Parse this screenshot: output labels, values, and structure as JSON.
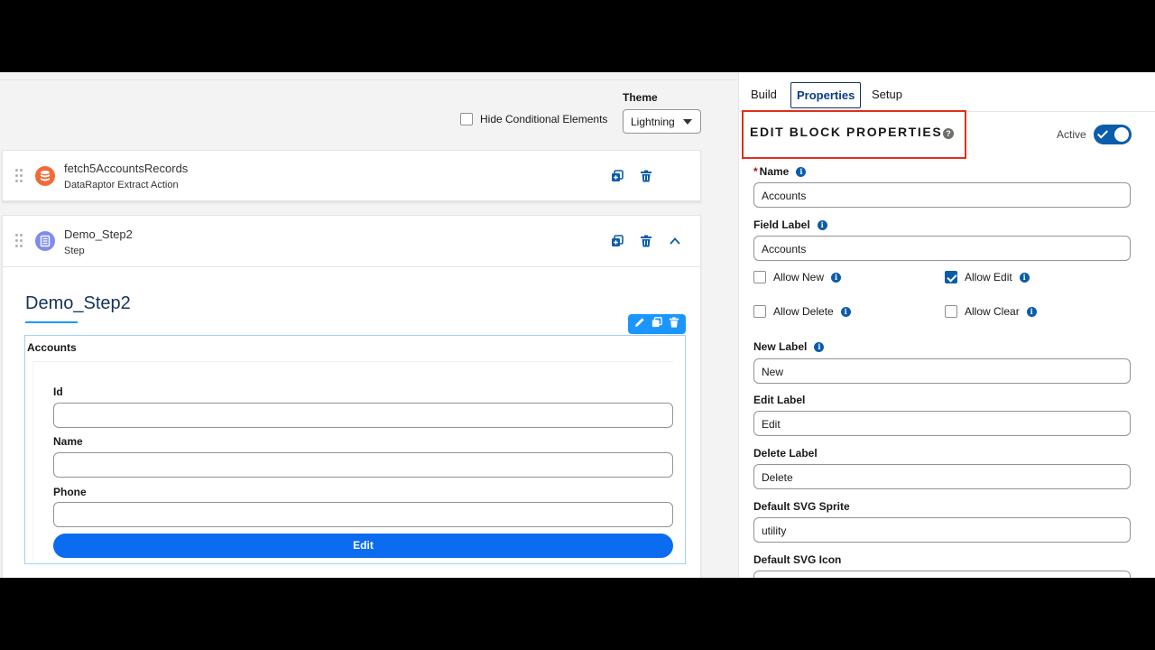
{
  "canvas": {
    "theme_label": "Theme",
    "theme_value": "Lightning",
    "hide_conditional_label": "Hide Conditional Elements",
    "elements": [
      {
        "name": "fetch5AccountsRecords",
        "type": "DataRaptor Extract Action",
        "icon": "database-icon",
        "color": "#f26a39"
      },
      {
        "name": "Demo_Step2",
        "type": "Step",
        "icon": "list-icon",
        "color": "#7f8ced"
      }
    ],
    "step_title": "Demo_Step2",
    "block": {
      "label": "Accounts",
      "fields": [
        {
          "label": "Id",
          "value": ""
        },
        {
          "label": "Name",
          "value": ""
        },
        {
          "label": "Phone",
          "value": ""
        }
      ],
      "edit_button": "Edit"
    }
  },
  "panel": {
    "tabs": [
      "Build",
      "Properties",
      "Setup"
    ],
    "active_tab": "Properties",
    "heading": "EDIT BLOCK PROPERTIES",
    "active_label": "Active",
    "active_on": true,
    "name_label": "Name",
    "name_value": "Accounts",
    "field_label_label": "Field Label",
    "field_label_value": "Accounts",
    "allow_new": {
      "label": "Allow New",
      "checked": false
    },
    "allow_edit": {
      "label": "Allow Edit",
      "checked": true
    },
    "allow_delete": {
      "label": "Allow Delete",
      "checked": false
    },
    "allow_clear": {
      "label": "Allow Clear",
      "checked": false
    },
    "new_label_label": "New Label",
    "new_label_value": "New",
    "edit_label_label": "Edit Label",
    "edit_label_value": "Edit",
    "delete_label_label": "Delete Label",
    "delete_label_value": "Delete",
    "default_svg_sprite_label": "Default SVG Sprite",
    "default_svg_sprite_value": "utility",
    "default_svg_icon_label": "Default SVG Icon",
    "default_svg_icon_value": ""
  },
  "colors": {
    "brand_blue": "#0b5cab",
    "button_blue": "#0b6cf0",
    "highlight_red": "#e0301e"
  }
}
